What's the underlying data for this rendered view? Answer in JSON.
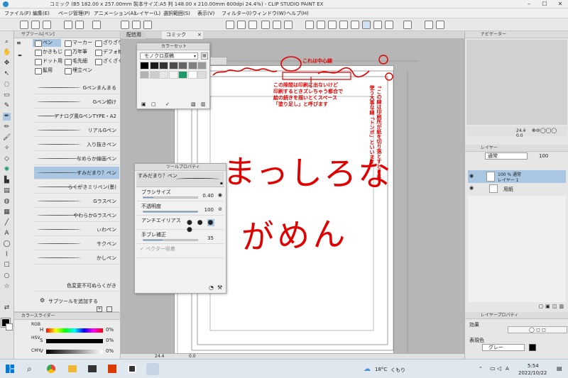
{
  "window": {
    "title": "コミック (B5 182.00 x 257.00mm 製本サイズ:A5 判 148.00 x 210.00mm 600dpi 24.4%) - CLIP STUDIO PAINT EX",
    "controls": [
      "–",
      "☐",
      "✕"
    ]
  },
  "menu": [
    "ファイル(F)",
    "編集(E)",
    "ページ管理(P)",
    "アニメーション(A)",
    "レイヤー(L)",
    "選択範囲(S)",
    "表示(V)",
    "フィルター(I)",
    "ウィンドウ(W)",
    "ヘルプ(H)"
  ],
  "subtool": {
    "header": "サブツール[ペン]",
    "groups": [
      "ペン",
      "マーカー",
      "ざりざり",
      "かきもじ",
      "万年筆",
      "デフォ格",
      "ドット用",
      "毛先細",
      "ざくざく",
      "髪用",
      "埋立ペン"
    ],
    "brushes": [
      "Gペンまんまる",
      "Gペン傾け",
      "アナログ風GペンTYPE・A2",
      "リアルGペン",
      "入り抜きペン",
      "なめらか線画ペン",
      "すみだまり？ペン",
      "らくがきミリペン(墨)",
      "Gラスペン",
      "やわらかGラスペン",
      "ぃわペン",
      "サクペン",
      "かしペン",
      "色変更不可ぬらくがき"
    ],
    "selected_brush": "すみだまり？ペン",
    "add_label": "サブツールを追加する"
  },
  "colorslider": {
    "header": "カラースライダー",
    "tabs": [
      "RGB",
      "HSV",
      "CMY"
    ],
    "rows": [
      {
        "label": "H",
        "value": "0%"
      },
      {
        "label": "S",
        "value": "0%"
      },
      {
        "label": "V",
        "value": "0%"
      }
    ]
  },
  "canvas": {
    "tabs": [
      "配信用",
      "コミック"
    ],
    "zoom": "24.4",
    "rotation": "0.0"
  },
  "colorset": {
    "header": "カラーセット",
    "preset": "モノクロ原稿",
    "swatches": [
      "#000000",
      "#1a1a1a",
      "#333333",
      "#4d4d4d",
      "#666666",
      "#808080",
      "#999999",
      "#b3b3b3",
      "#cccccc",
      "#e6e6e6",
      "#f2f2f2",
      "#1d9a6a",
      "#ffffff",
      "#dddddd"
    ]
  },
  "toolprop": {
    "header": "ツールプロパティ",
    "brush_name": "すみだまり？ペン",
    "rows": [
      {
        "label": "ブラシサイズ",
        "value": "0.40",
        "level": 0.18
      },
      {
        "label": "不透明度",
        "value": "100",
        "level": 1.0
      },
      {
        "label": "アンチエイリアス",
        "value": "",
        "level": 0
      },
      {
        "label": "手ブレ補正",
        "value": "35",
        "level": 0.35
      },
      {
        "label": "ベクター吸着",
        "value": "",
        "level": 0
      }
    ]
  },
  "annotations": {
    "center_line": "これは中心線",
    "bleed_note": "この隙間は印刷に出ないけど\n印刷するときズレちゃう都合で\n絵の続きを描いとくスペース\n「塗り足し」と呼びます",
    "tombo_note": "↑この線は印刷所が紙を切り落とすときに\n使う大事な線「トンボ」といいます",
    "handwriting_1": "まっしろな",
    "handwriting_2": "がめん"
  },
  "right": {
    "navigator": "ナビゲーター",
    "zoom": "24.4",
    "rotation": "0.0",
    "layer_header": "レイヤー",
    "blend": "通常",
    "opacity": "100",
    "layers": [
      {
        "pct": "100 % 通常",
        "name": "レイヤー 1",
        "selected": true
      },
      {
        "pct": "",
        "name": "用紙",
        "selected": false
      }
    ],
    "layerprop_header": "レイヤープロパティ",
    "effect_label": "効果",
    "display_color_label": "表現色",
    "display_color_value": "グレー"
  },
  "taskbar": {
    "weather_temp": "18°C",
    "weather_desc": "くもり",
    "ime": "A",
    "time": "5:54",
    "date": "2022/10/22"
  },
  "colors": {
    "accent": "#a9c6e3",
    "annotation": "#e00000"
  }
}
